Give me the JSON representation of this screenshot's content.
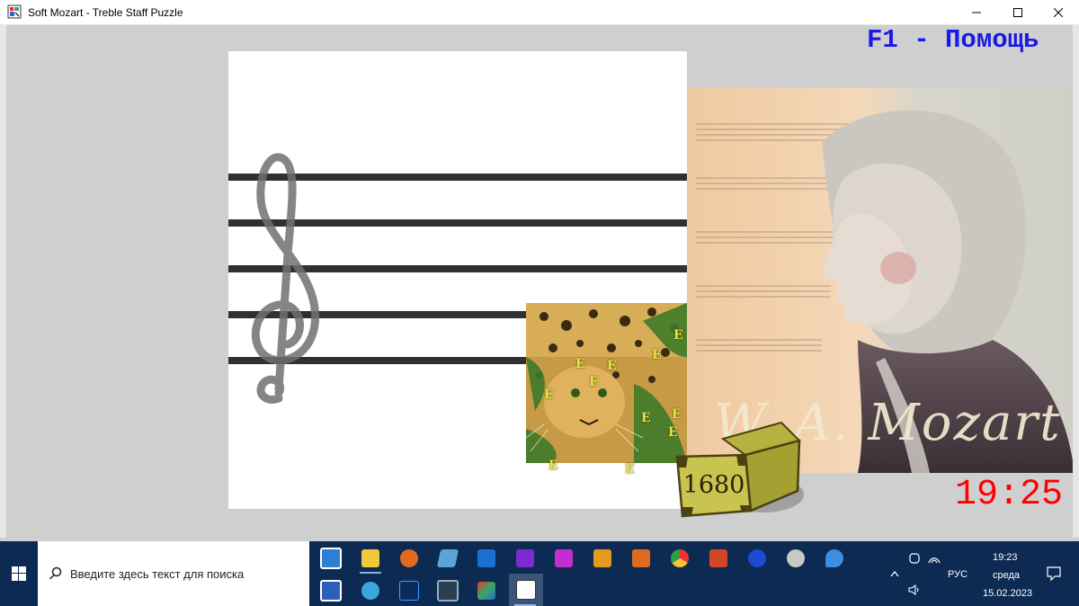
{
  "window": {
    "title": "Soft Mozart - Treble Staff Puzzle",
    "min_glyph": "—",
    "max_glyph": "☐",
    "close_glyph": "✕"
  },
  "game": {
    "help_label": "F1 - Помощь",
    "score": "1680",
    "timer": "19:25",
    "signature": "W. A. Mozart",
    "card_letter": "E",
    "colors": {
      "help": "#1a1ae6",
      "timer": "#ff0000",
      "staff": "#303030"
    }
  },
  "taskbar": {
    "search_placeholder": "Введите здесь текст для поиска",
    "language": "РУС",
    "time": "19:23",
    "day": "среда",
    "date": "15.02.2023",
    "icons": [
      "store-icon",
      "file-explorer-icon",
      "search-app-icon",
      "notes-icon",
      "blue-app-icon",
      "xmind-icon",
      "xmind-alt-icon",
      "music-app-icon",
      "video-player-icon",
      "chrome-icon",
      "powerpoint-icon",
      "media-icon",
      "cloud-app-icon",
      "edge-legacy-icon",
      "word-icon",
      "browser-icon",
      "photoshop-icon",
      "film-app-icon",
      "installer-icon",
      "soft-mozart-icon"
    ]
  }
}
